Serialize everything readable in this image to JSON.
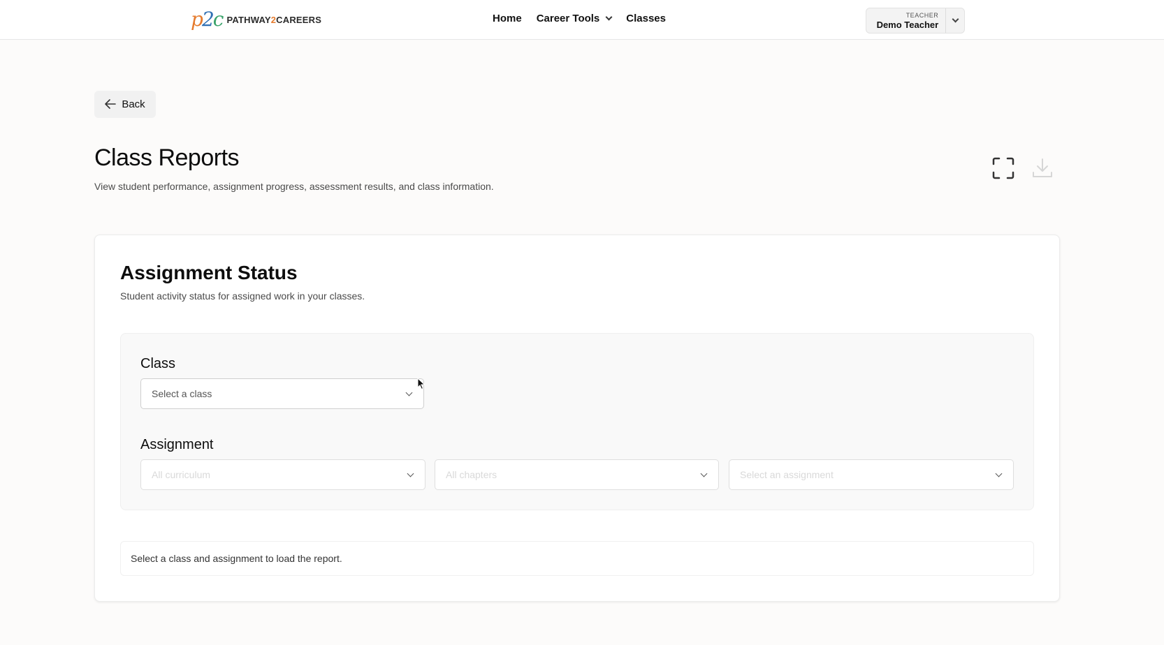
{
  "header": {
    "logo_mark": {
      "p": "p",
      "two": "2",
      "c": "c"
    },
    "logo_text": {
      "pre": "PATHWAY",
      "num": "2",
      "post": "CAREERS"
    },
    "nav": [
      {
        "label": "Home"
      },
      {
        "label": "Career Tools",
        "has_dropdown": true
      },
      {
        "label": "Classes"
      }
    ],
    "user": {
      "role": "TEACHER",
      "name": "Demo Teacher"
    }
  },
  "page": {
    "back_label": "Back",
    "title": "Class Reports",
    "subtitle": "View student performance, assignment progress, assessment results, and class information.",
    "actions": [
      "fullscreen-icon",
      "download-icon"
    ]
  },
  "card": {
    "title": "Assignment Status",
    "subtitle": "Student activity status for assigned work in your classes.",
    "filters": {
      "class_label": "Class",
      "class_select": "Select a class",
      "assignment_label": "Assignment",
      "curriculum_select": "All curriculum",
      "chapters_select": "All chapters",
      "assignment_select": "Select an assignment"
    },
    "notice": "Select a class and assignment to load the report."
  },
  "colors": {
    "logo_orange": "#e57b2e",
    "logo_blue": "#2f6fb3",
    "logo_green": "#3aa36b",
    "page_bg": "#fcfbfa"
  }
}
